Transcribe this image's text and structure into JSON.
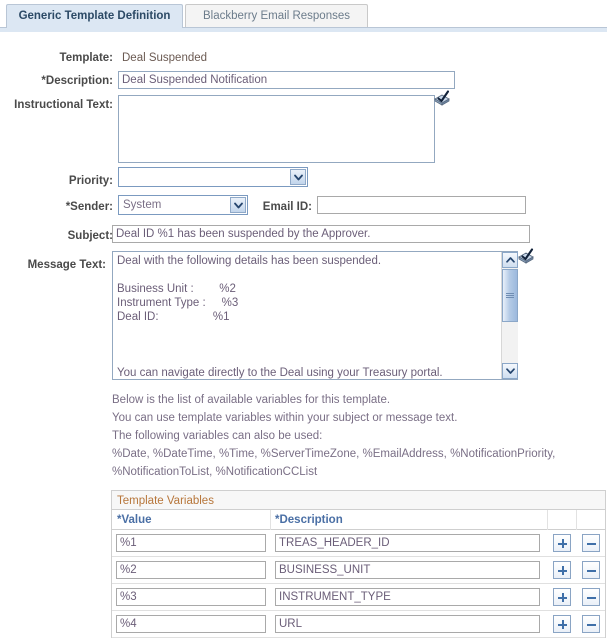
{
  "tabs": [
    {
      "label": "Generic Template Definition",
      "active": true
    },
    {
      "label": "Blackberry Email Responses",
      "active": false
    }
  ],
  "form": {
    "template_label": "Template:",
    "template_value": "Deal Suspended",
    "description_label": "*Description:",
    "description_value": "Deal Suspended Notification",
    "instructional_label": "Instructional Text:",
    "instructional_value": "",
    "priority_label": "Priority:",
    "priority_value": "",
    "sender_label": "*Sender:",
    "sender_value": "System",
    "email_id_label": "Email ID:",
    "email_id_value": "",
    "subject_label": "Subject:",
    "subject_value": "Deal ID %1 has been suspended by the Approver.",
    "message_label": "Message Text:",
    "message_value": "Deal with the following details has been suspended.\n\nBusiness Unit :        %2\nInstrument Type :     %3\nDeal ID:                 %1\n\n\n\nYou can navigate directly to the Deal using your Treasury portal."
  },
  "instructions": [
    "Below is the list of available variables for this template.",
    "You can use template variables within your subject or message text.",
    "The following variables can also be used:",
    "%Date, %DateTime, %Time, %ServerTimeZone, %EmailAddress, %NotificationPriority,",
    "%NotificationToList, %NotificationCCList"
  ],
  "grid": {
    "title": "Template Variables",
    "columns": [
      "*Value",
      "*Description"
    ],
    "rows": [
      {
        "value": "%1",
        "description": "TREAS_HEADER_ID",
        "add": "+",
        "remove": "−"
      },
      {
        "value": "%2",
        "description": "BUSINESS_UNIT",
        "add": "+",
        "remove": "−"
      },
      {
        "value": "%3",
        "description": "INSTRUMENT_TYPE",
        "add": "+",
        "remove": "−"
      },
      {
        "value": "%4",
        "description": "URL",
        "add": "+",
        "remove": "−"
      }
    ]
  },
  "icons": {
    "spellcheck": "spellcheck-notepad-icon",
    "scroll_up": "scroll-up-arrow-icon",
    "scroll_down": "scroll-down-arrow-icon",
    "dropdown": "chevron-down-icon"
  },
  "colors": {
    "tab_active_bg": "#dce7f3",
    "grid_title": "#b7763a",
    "grid_header_text": "#4a6fa5",
    "field_text": "#6b5e78",
    "label_text": "#4a4a4a"
  }
}
